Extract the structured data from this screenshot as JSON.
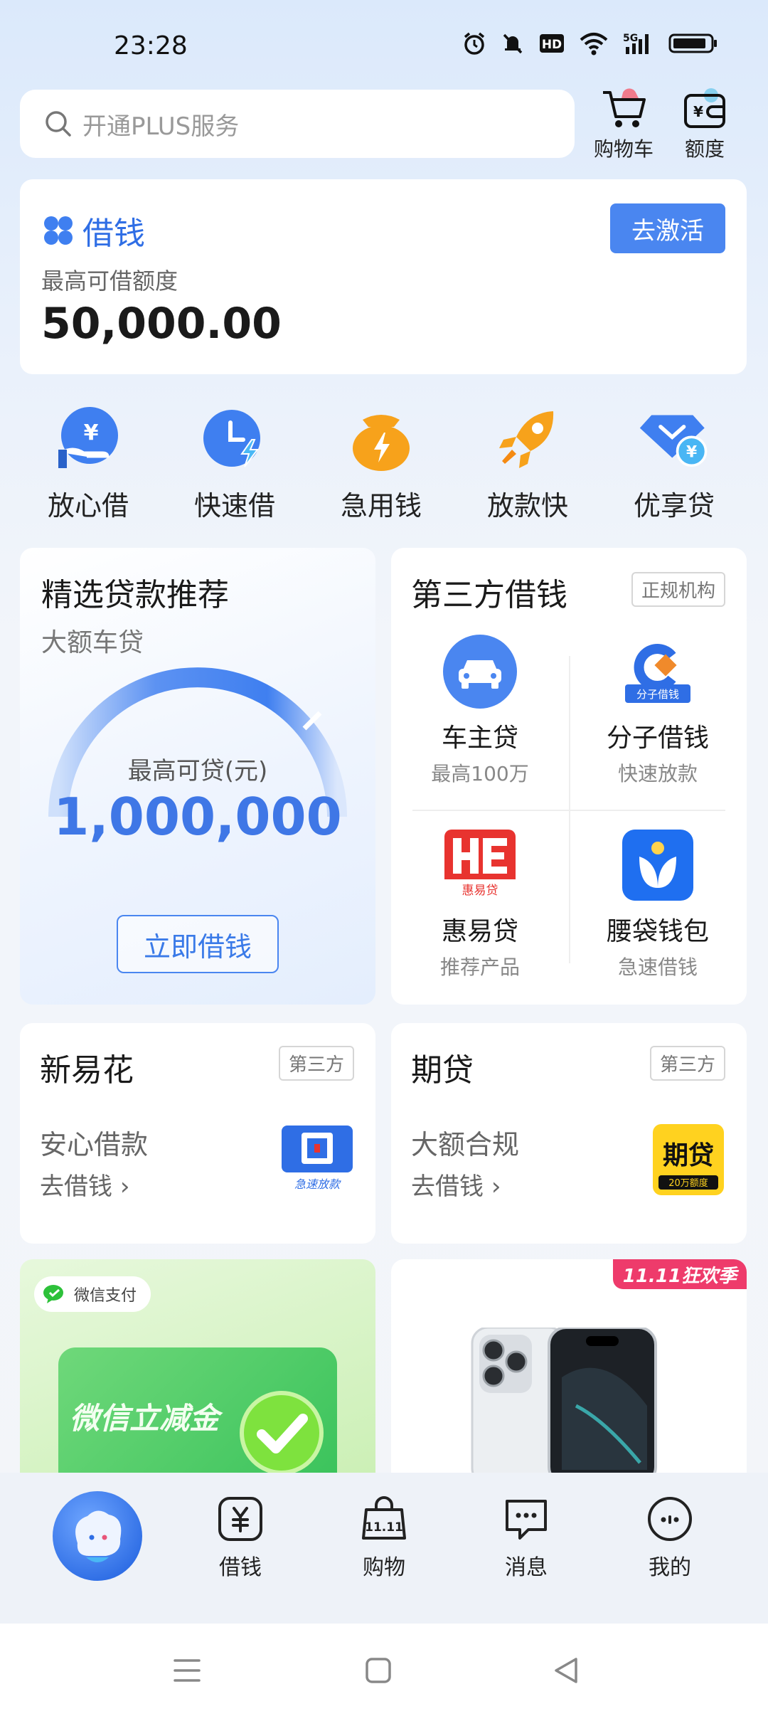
{
  "status_bar": {
    "time": "23:28",
    "network": "5G"
  },
  "search": {
    "placeholder": "开通PLUS服务"
  },
  "top_actions": {
    "cart": "购物车",
    "quota": "额度"
  },
  "loan": {
    "title": "借钱",
    "activate": "去激活",
    "limit_label": "最高可借额度",
    "limit_amount": "50,000.00"
  },
  "quick_actions": [
    {
      "label": "放心借",
      "icon": "hand-yuan-icon"
    },
    {
      "label": "快速借",
      "icon": "clock-bolt-icon"
    },
    {
      "label": "急用钱",
      "icon": "money-bag-icon"
    },
    {
      "label": "放款快",
      "icon": "rocket-icon"
    },
    {
      "label": "优享贷",
      "icon": "diamond-yuan-icon"
    }
  ],
  "recommend": {
    "title": "精选贷款推荐",
    "subtitle": "大额车贷",
    "max_label": "最高可贷(元)",
    "max_value": "1,000,000",
    "button": "立即借钱"
  },
  "third_party": {
    "title": "第三方借钱",
    "tag": "正规机构",
    "items": [
      {
        "name": "车主贷",
        "desc": "最高100万"
      },
      {
        "name": "分子借钱",
        "desc": "快速放款",
        "logo_text": "分子借钱"
      },
      {
        "name": "惠易贷",
        "desc": "推荐产品",
        "logo_text": "惠易贷"
      },
      {
        "name": "腰袋钱包",
        "desc": "急速借钱"
      }
    ]
  },
  "cards": [
    {
      "title": "新易花",
      "tag": "第三方",
      "desc": "安心借款",
      "link": "去借钱",
      "logo_text": "急速放款"
    },
    {
      "title": "期贷",
      "tag": "第三方",
      "desc": "大额合规",
      "link": "去借钱",
      "logo_text": "期贷",
      "logo_sub": "20万额度"
    }
  ],
  "promo": {
    "wechat_badge": "微信支付",
    "left_text": "微信立减金",
    "sale_badge": "11.11狂欢季"
  },
  "bottom_nav": {
    "items": [
      {
        "label": "借钱",
        "icon": "yuan-box-icon"
      },
      {
        "label": "购物",
        "icon": "shopping-bag-icon"
      },
      {
        "label": "消息",
        "icon": "chat-bubble-icon"
      },
      {
        "label": "我的",
        "icon": "dots-circle-icon"
      }
    ]
  },
  "colors": {
    "accent": "#4a86f0",
    "brand_text": "#2f6ee5",
    "sale": "#ee3b6b"
  }
}
